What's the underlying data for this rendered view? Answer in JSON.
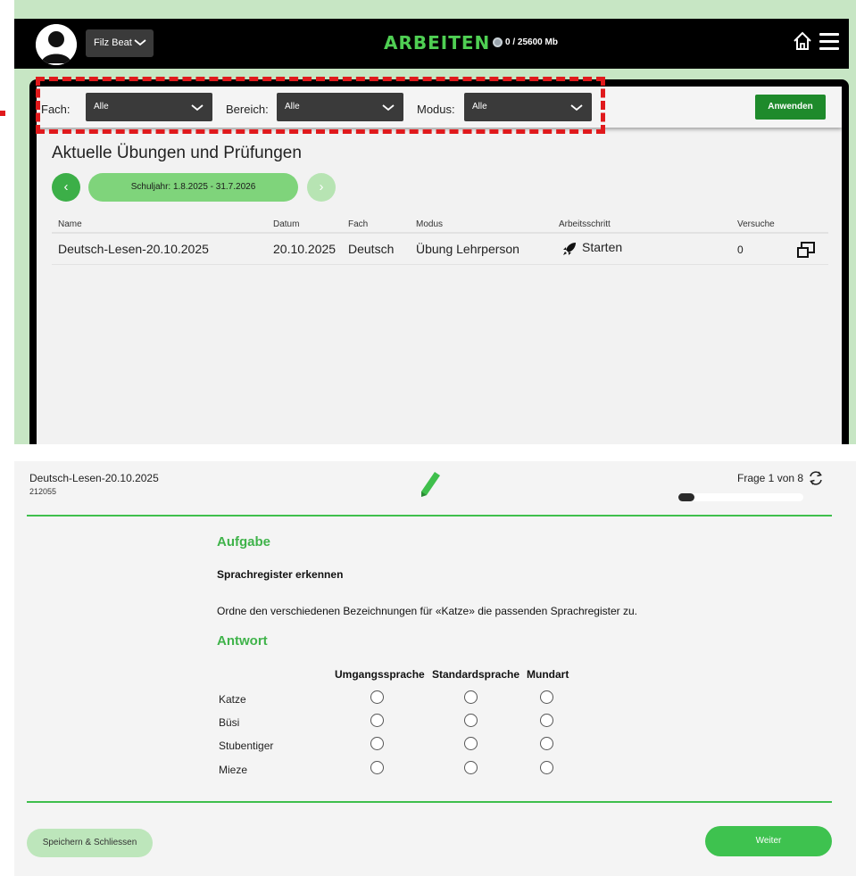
{
  "header": {
    "user": "Filz Beat",
    "title": "ARBEITEN",
    "storage": "0 / 25600 Mb"
  },
  "filters": {
    "fach_label": "Fach:",
    "fach_value": "Alle",
    "bereich_label": "Bereich:",
    "bereich_value": "Alle",
    "modus_label": "Modus:",
    "modus_value": "Alle",
    "apply": "Anwenden"
  },
  "section": {
    "title": "Aktuelle Übungen und Prüfungen",
    "prev": "‹",
    "year": "Schuljahr: 1.8.2025 - 31.7.2026",
    "next": "›"
  },
  "table": {
    "headers": [
      "Name",
      "Datum",
      "Fach",
      "Modus",
      "Arbeitsschritt",
      "Versuche"
    ],
    "rows": [
      {
        "name": "Deutsch-Lesen-20.10.2025",
        "datum": "20.10.2025",
        "fach": "Deutsch",
        "modus": "Übung Lehrperson",
        "schritt": "Starten",
        "versuche": "0"
      }
    ]
  },
  "question": {
    "title": "Deutsch-Lesen-20.10.2025",
    "id": "212055",
    "frage": "Frage 1 von 8",
    "progress": 0.125,
    "aufgabe_heading": "Aufgabe",
    "aufgabe_subtitle": "Sprachregister erkennen",
    "aufgabe_text": "Ordne den verschiedenen Bezeichnungen für «Katze» die passenden Sprachregister zu.",
    "antwort_heading": "Antwort",
    "columns": [
      "Umgangssprache",
      "Standardsprache",
      "Mundart"
    ],
    "rows": [
      "Katze",
      "Büsi",
      "Stubentiger",
      "Mieze"
    ]
  },
  "footer": {
    "save": "Speichern & Schliessen",
    "next": "Weiter"
  },
  "colors": {
    "accent_green": "#3fbf4c",
    "title_green": "#4fcf53",
    "apply_green": "#1e8a2b",
    "highlight_red": "#e0191c"
  },
  "icons": [
    "avatar-icon",
    "chevron-down-icon",
    "disk-icon",
    "home-icon",
    "menu-icon",
    "rocket-icon",
    "open-window-icon",
    "pencil-icon",
    "refresh-icon"
  ]
}
